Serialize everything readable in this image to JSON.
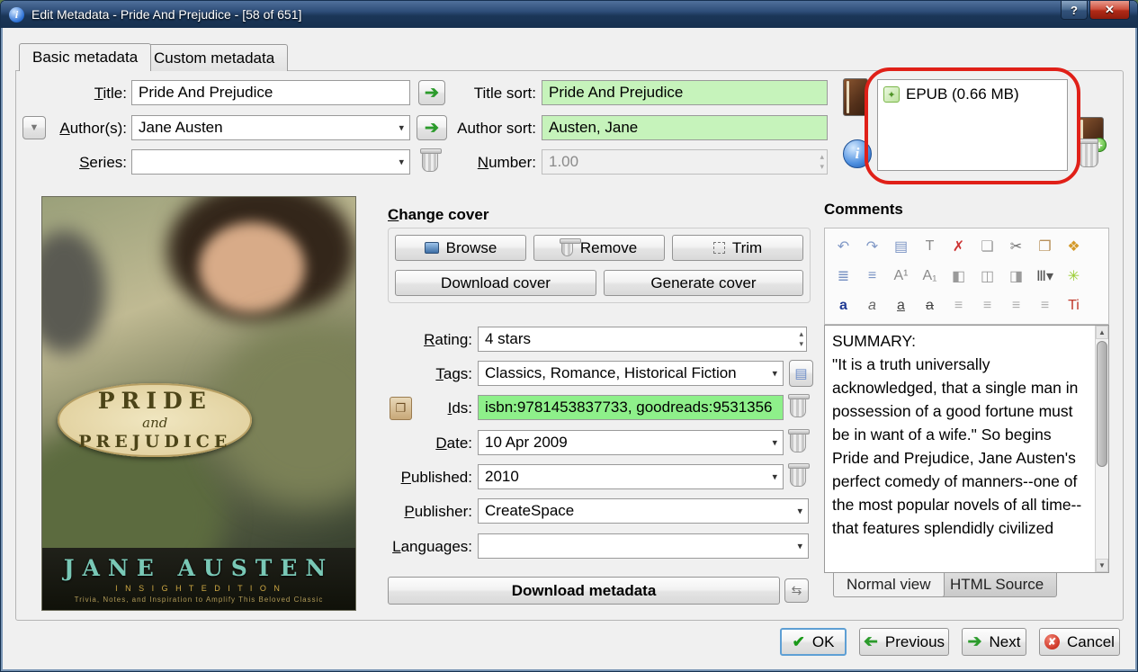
{
  "window": {
    "title": "Edit Metadata - Pride And Prejudice -  [58 of 651]",
    "help": "?",
    "close": "✕"
  },
  "tabs": [
    {
      "label": "Basic metadata"
    },
    {
      "label": "Custom metadata"
    }
  ],
  "form": {
    "title": {
      "label": "Title:",
      "value": "Pride And Prejudice"
    },
    "title_sort": {
      "label": "Title sort:",
      "value": "Pride And Prejudice"
    },
    "authors": {
      "label": "Author(s):",
      "value": "Jane Austen"
    },
    "author_sort": {
      "label": "Author sort:",
      "value": "Austen, Jane"
    },
    "series": {
      "label": "Series:",
      "value": ""
    },
    "number": {
      "label": "Number:",
      "value": "1.00"
    }
  },
  "formats": {
    "items": [
      {
        "label": "EPUB (0.66 MB)"
      }
    ]
  },
  "cover_art": {
    "line1": "PRIDE",
    "line2": "and",
    "line3": "PREJUDICE",
    "author": "JANE AUSTEN",
    "edition": "I N S I G H T   E D I T I O N",
    "tagline": "Trivia, Notes, and Inspiration to Amplify This Beloved Classic"
  },
  "change_cover": {
    "heading": "Change cover",
    "browse": "Browse",
    "remove": "Remove",
    "trim": "Trim",
    "download": "Download cover",
    "generate": "Generate cover"
  },
  "details": {
    "rating": {
      "label": "Rating:",
      "value": "4 stars"
    },
    "tags": {
      "label": "Tags:",
      "value": "Classics, Romance, Historical Fiction"
    },
    "ids": {
      "label": "Ids:",
      "value": "isbn:9781453837733, goodreads:9531356"
    },
    "date": {
      "label": "Date:",
      "value": "10 Apr 2009"
    },
    "published": {
      "label": "Published:",
      "value": "2010"
    },
    "publisher": {
      "label": "Publisher:",
      "value": "CreateSpace"
    },
    "languages": {
      "label": "Languages:",
      "value": ""
    },
    "download_metadata": "Download metadata"
  },
  "comments": {
    "heading": "Comments",
    "text": "SUMMARY:\n\"It is a truth universally acknowledged, that a single man in possession of a good fortune must be in want of a wife.\" So begins Pride and Prejudice, Jane Austen's perfect comedy of manners--one of the most popular novels of all time--that features splendidly civilized",
    "tabs": [
      {
        "label": "Normal view"
      },
      {
        "label": "HTML Source"
      }
    ],
    "toolbar": {
      "rows": [
        [
          {
            "name": "undo-icon",
            "glyph": "↶",
            "color": "#8098c6"
          },
          {
            "name": "redo-icon",
            "glyph": "↷",
            "color": "#8098c6"
          },
          {
            "name": "select-all-icon",
            "glyph": "▤",
            "color": "#7b94c4"
          },
          {
            "name": "font-size-icon",
            "glyph": "T",
            "color": "#8a8a8a"
          },
          {
            "name": "remove-formatting-icon",
            "glyph": "✗",
            "color": "#cc3333"
          },
          {
            "name": "copy-icon",
            "glyph": "❏",
            "color": "#9a9a9a"
          },
          {
            "name": "cut-icon",
            "glyph": "✂",
            "color": "#6f6f6f"
          },
          {
            "name": "paste-icon",
            "glyph": "❐",
            "color": "#b8905a"
          },
          {
            "name": "smarten-punctuation-icon",
            "glyph": "❖",
            "color": "#d49a2a"
          }
        ],
        [
          {
            "name": "ordered-list-icon",
            "glyph": "≣",
            "color": "#7b94c4"
          },
          {
            "name": "bullet-list-icon",
            "glyph": "≡",
            "color": "#7b94c4"
          },
          {
            "name": "superscript-icon",
            "glyph": "A¹",
            "color": "#8a8a8a"
          },
          {
            "name": "subscript-icon",
            "glyph": "A₁",
            "color": "#8a8a8a"
          },
          {
            "name": "align-left-icon",
            "glyph": "◧",
            "color": "#9a9a9a"
          },
          {
            "name": "align-center-icon",
            "glyph": "◫",
            "color": "#9a9a9a"
          },
          {
            "name": "align-right-icon",
            "glyph": "◨",
            "color": "#9a9a9a"
          },
          {
            "name": "table-columns-icon",
            "glyph": "Ⅲ▾",
            "color": "#555555"
          },
          {
            "name": "insert-separator-icon",
            "glyph": "✳",
            "color": "#9acd32"
          }
        ],
        [
          {
            "name": "bold-icon",
            "glyph": "a",
            "color": "#1f3a93",
            "bold": true
          },
          {
            "name": "italic-icon",
            "glyph": "a",
            "color": "#666666",
            "italic": true
          },
          {
            "name": "underline-icon",
            "glyph": "a",
            "color": "#444444",
            "underline": true
          },
          {
            "name": "strikethrough-icon",
            "glyph": "a",
            "color": "#444444",
            "strike": true
          },
          {
            "name": "align-justify-icon",
            "glyph": "≡",
            "color": "#b0b0b0"
          },
          {
            "name": "indent-decrease-icon",
            "glyph": "≡",
            "color": "#b0b0b0"
          },
          {
            "name": "indent-increase-icon",
            "glyph": "≡",
            "color": "#b0b0b0"
          },
          {
            "name": "line-spacing-icon",
            "glyph": "≡",
            "color": "#b0b0b0"
          },
          {
            "name": "font-color-icon",
            "glyph": "Ti",
            "color": "#c0392b"
          }
        ]
      ]
    }
  },
  "footer": {
    "ok": "OK",
    "previous": "Previous",
    "next": "Next",
    "cancel": "Cancel"
  },
  "colors": {
    "sort_field_green": "#c6f3bb",
    "ids_field_green": "#8ef08a",
    "annotation_red": "#e02018",
    "titlebar_blue": "#1b3658"
  }
}
